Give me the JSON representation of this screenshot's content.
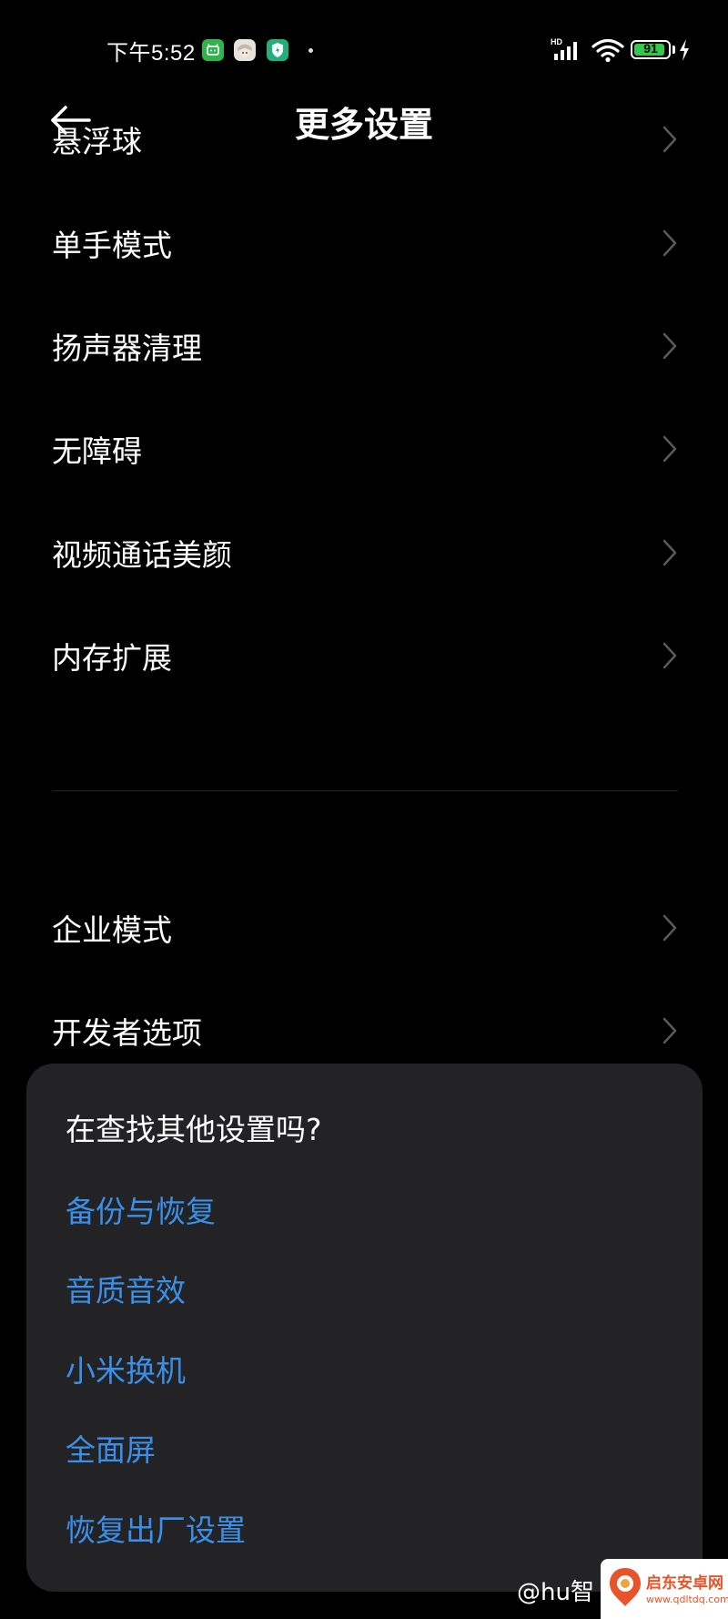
{
  "status_bar": {
    "time": "下午5:52",
    "notification_icons": [
      "android-app-icon",
      "avatar-app-icon",
      "security-shield-icon"
    ],
    "network_label": "HD",
    "battery_level": "91",
    "battery_percent": 91,
    "charging": true
  },
  "header": {
    "title": "更多设置",
    "back_icon": "back-arrow-icon"
  },
  "settings_group_1": [
    {
      "label": "悬浮球"
    },
    {
      "label": "单手模式"
    },
    {
      "label": "扬声器清理"
    },
    {
      "label": "无障碍"
    },
    {
      "label": "视频通话美颜"
    },
    {
      "label": "内存扩展"
    }
  ],
  "settings_group_2": [
    {
      "label": "企业模式"
    },
    {
      "label": "开发者选项"
    }
  ],
  "suggestions": {
    "title": "在查找其他设置吗?",
    "links": [
      {
        "label": "备份与恢复"
      },
      {
        "label": "音质音效"
      },
      {
        "label": "小米换机"
      },
      {
        "label": "全面屏"
      },
      {
        "label": "恢复出厂设置"
      }
    ]
  },
  "watermark": {
    "text": "@hu智",
    "logo_name": "启东安卓网",
    "logo_url": "www.qdltdq.com"
  },
  "colors": {
    "background": "#000000",
    "card": "#232325",
    "link": "#3a8fe8",
    "chevron": "#5a5a5a",
    "battery": "#34c94a"
  }
}
